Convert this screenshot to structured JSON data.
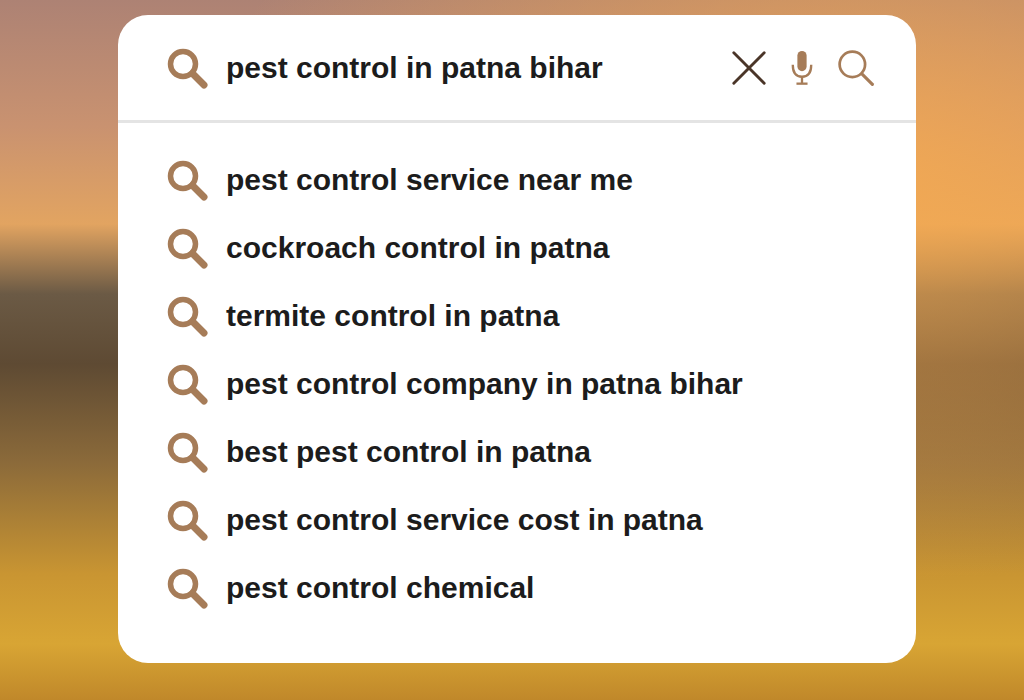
{
  "search": {
    "query": "pest control in patna bihar"
  },
  "suggestions": [
    {
      "text": "pest control service near me"
    },
    {
      "text": "cockroach control in patna"
    },
    {
      "text": "termite control in patna"
    },
    {
      "text": "pest control company in patna bihar"
    },
    {
      "text": "best pest control in patna"
    },
    {
      "text": "pest control service cost in patna"
    },
    {
      "text": "pest control chemical"
    }
  ]
}
